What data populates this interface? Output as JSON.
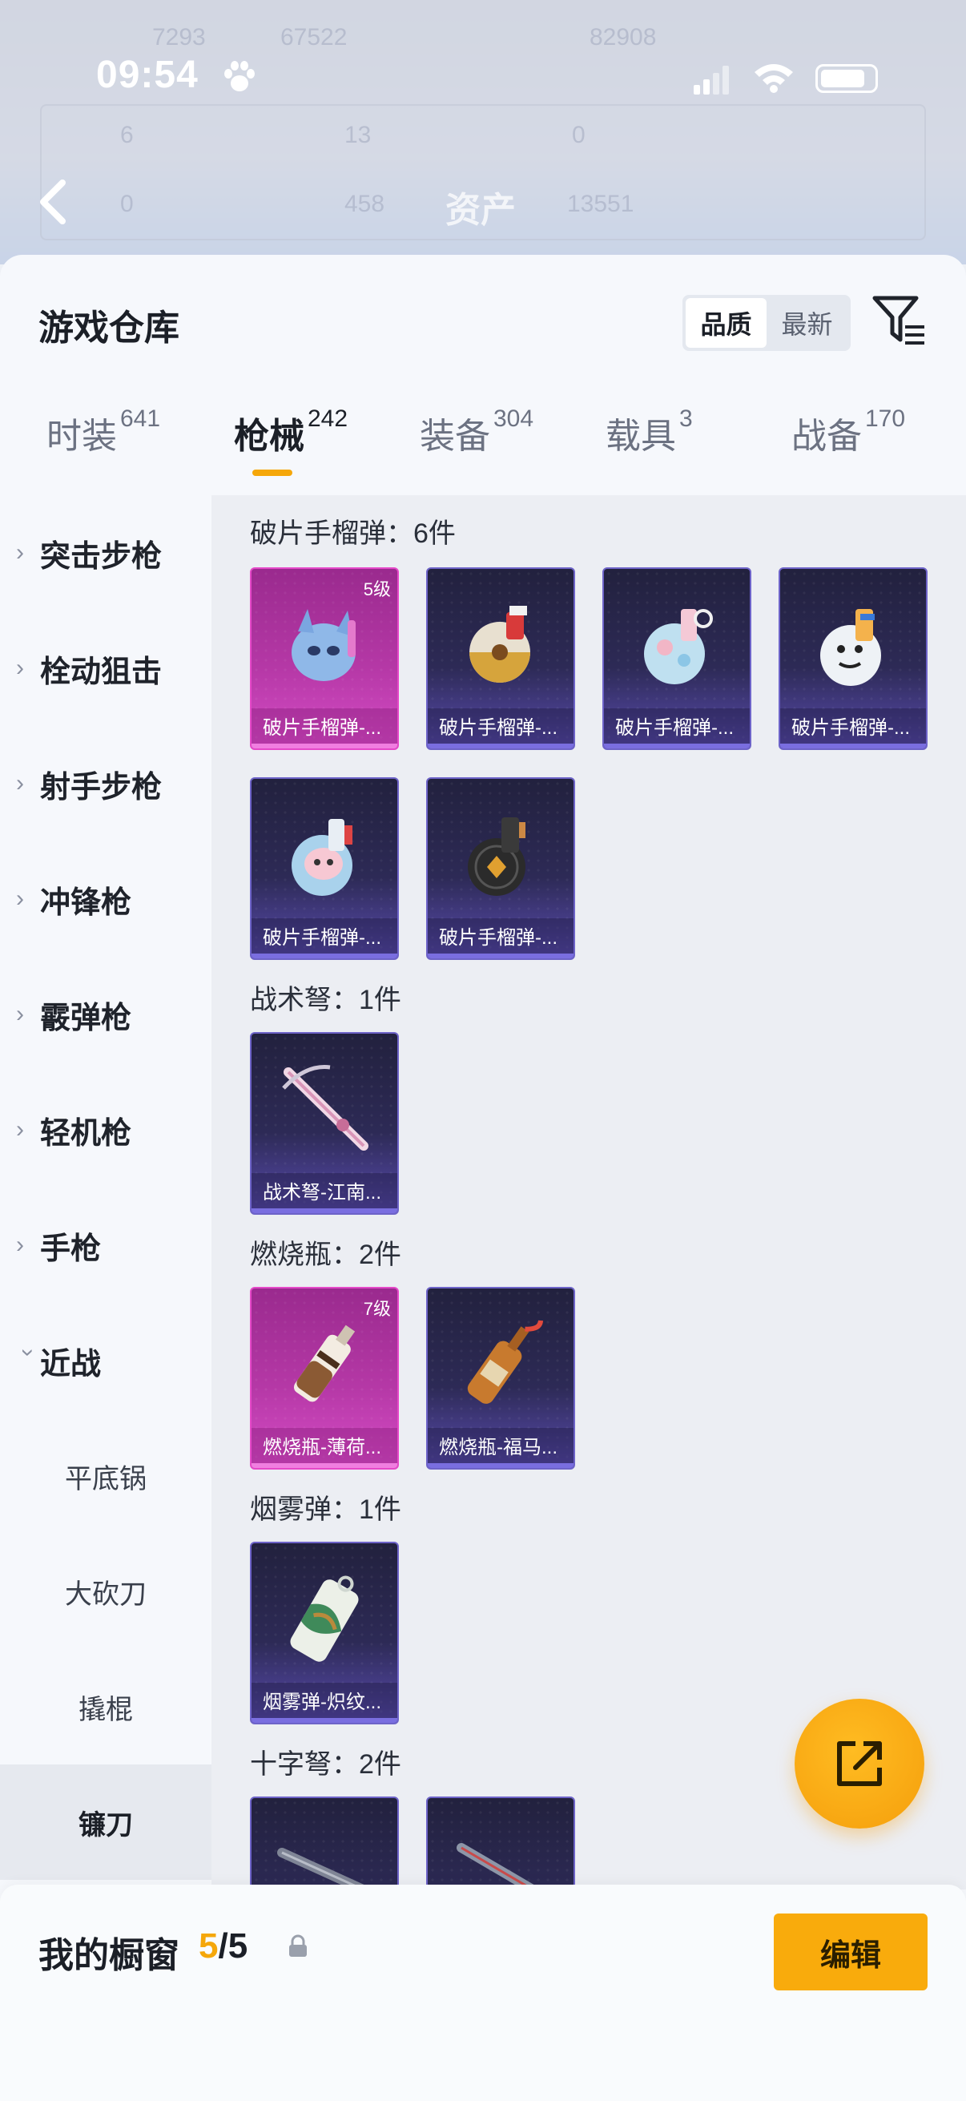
{
  "status_bar": {
    "time": "09:54"
  },
  "background": {
    "title": "资产",
    "faded_stats": [
      "7293",
      "67522",
      "82908",
      "6",
      "13",
      "0",
      "0",
      "458",
      "13551"
    ]
  },
  "sheet": {
    "title": "游戏仓库",
    "sort_options": [
      "品质",
      "最新"
    ],
    "sort_selected": "品质"
  },
  "tabs": [
    {
      "label": "时装",
      "count": "641"
    },
    {
      "label": "枪械",
      "count": "242",
      "active": true
    },
    {
      "label": "装备",
      "count": "304"
    },
    {
      "label": "载具",
      "count": "3"
    },
    {
      "label": "战备",
      "count": "170"
    }
  ],
  "sidebar": {
    "categories": [
      "突击步枪",
      "栓动狙击",
      "射手步枪",
      "冲锋枪",
      "霰弹枪",
      "轻机枪",
      "手枪",
      "近战"
    ],
    "expanded": "近战",
    "subitems": [
      "平底锅",
      "大砍刀",
      "撬棍",
      "镰刀"
    ],
    "selected_sub": "镰刀"
  },
  "sections": [
    {
      "title": "破片手榴弹：6件",
      "items": [
        {
          "caption": "破片手榴弹-...",
          "level": "5级",
          "rarity": "pink"
        },
        {
          "caption": "破片手榴弹-...",
          "rarity": "purple"
        },
        {
          "caption": "破片手榴弹-...",
          "rarity": "purple"
        },
        {
          "caption": "破片手榴弹-...",
          "rarity": "purple"
        },
        {
          "caption": "破片手榴弹-...",
          "rarity": "purple"
        },
        {
          "caption": "破片手榴弹-...",
          "rarity": "purple"
        }
      ]
    },
    {
      "title": "战术弩：1件",
      "items": [
        {
          "caption": "战术弩-江南...",
          "rarity": "purple"
        }
      ]
    },
    {
      "title": "燃烧瓶：2件",
      "items": [
        {
          "caption": "燃烧瓶-薄荷...",
          "level": "7级",
          "rarity": "pink"
        },
        {
          "caption": "燃烧瓶-福马...",
          "rarity": "purple"
        }
      ]
    },
    {
      "title": "烟雾弹：1件",
      "items": [
        {
          "caption": "烟雾弹-炽纹...",
          "rarity": "purple"
        }
      ]
    },
    {
      "title": "十字弩：2件",
      "items": [
        {
          "caption": "",
          "rarity": "purple"
        },
        {
          "caption": "",
          "rarity": "purple"
        }
      ]
    }
  ],
  "bottom_bar": {
    "label": "我的橱窗",
    "count_current": "5",
    "count_separator": "/",
    "count_total": "5",
    "edit_label": "编辑"
  },
  "colors": {
    "accent": "#f5a70a",
    "pink_rarity": "#e548c8",
    "purple_rarity": "#6d63c8"
  }
}
